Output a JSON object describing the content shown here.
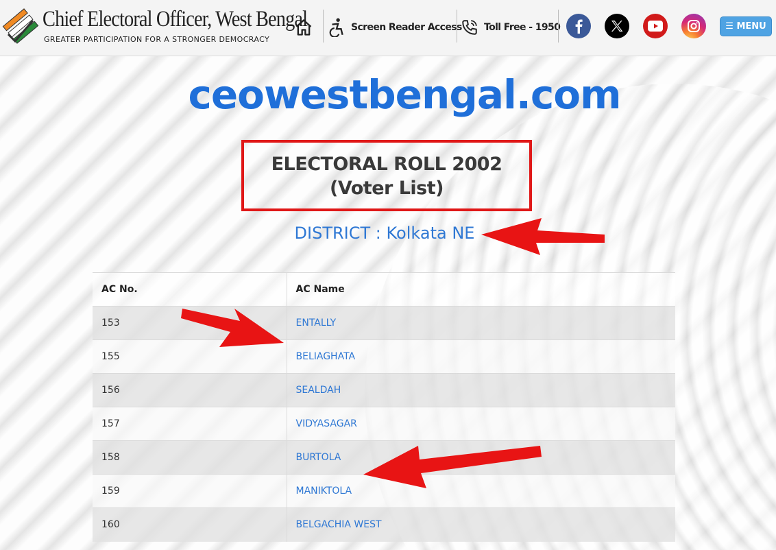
{
  "header": {
    "title": "Chief Electoral Officer, West Bengal",
    "tagline": "GREATER PARTICIPATION FOR A STRONGER DEMOCRACY",
    "screen_reader_label": "Screen Reader Access",
    "toll_free_label": "Toll Free - 1950",
    "menu_label": "☰ MENU",
    "social": [
      "facebook",
      "x",
      "youtube",
      "instagram"
    ]
  },
  "main": {
    "brand": "ceowestbengal.com",
    "roll_title": "ELECTORAL ROLL 2002",
    "roll_subtitle": "(Voter List)",
    "district": "DISTRICT : Kolkata NE"
  },
  "table": {
    "headers": [
      "AC No.",
      "AC Name"
    ],
    "rows": [
      {
        "no": "153",
        "name": "ENTALLY"
      },
      {
        "no": "155",
        "name": "BELIAGHATA"
      },
      {
        "no": "156",
        "name": "SEALDAH"
      },
      {
        "no": "157",
        "name": "VIDYASAGAR"
      },
      {
        "no": "158",
        "name": "BURTOLA"
      },
      {
        "no": "159",
        "name": "MANIKTOLA"
      },
      {
        "no": "160",
        "name": "BELGACHIA WEST"
      }
    ]
  },
  "colors": {
    "accent": "#1f6fd9",
    "link": "#2f78d4",
    "highlight": "#e01818",
    "menu": "#4fa3e3"
  }
}
